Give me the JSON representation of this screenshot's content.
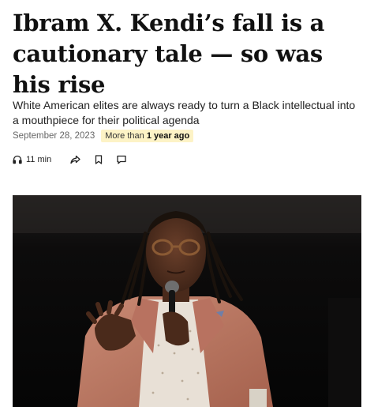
{
  "article": {
    "headline": "Ibram X. Kendi’s fall is a cautionary tale — so was his rise",
    "subheadline": "White American elites are always ready to turn a Black intellectual into a mouthpiece for their political agenda",
    "date": "September 28, 2023",
    "age_badge": {
      "prefix": "More than",
      "value": "1 year ago"
    }
  },
  "actions": {
    "listen_time": "11 min",
    "icons": [
      "headphones-icon",
      "share-icon",
      "bookmark-icon",
      "comment-icon"
    ]
  },
  "colors": {
    "badge_bg": "#fdf3c6",
    "headline": "#111111",
    "meta": "#666666"
  }
}
